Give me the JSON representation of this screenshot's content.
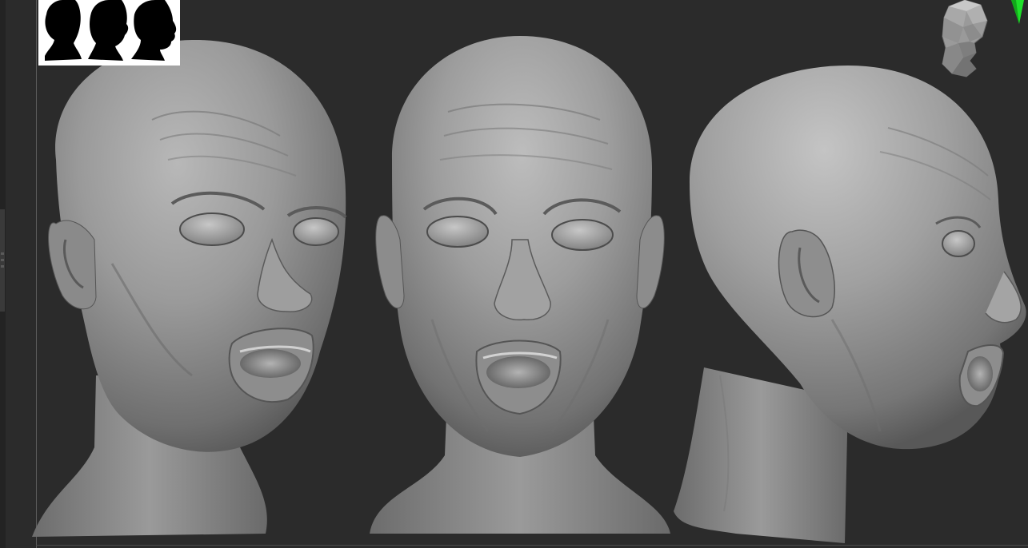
{
  "app": {
    "canvas_background": "#2b2b2b"
  },
  "reference_image": {
    "icon": "head-silhouettes-icon",
    "views": [
      "front",
      "three-quarter",
      "side"
    ],
    "silhouette_color": "#000000",
    "background_color": "#ffffff"
  },
  "models": [
    {
      "view": "three-quarter",
      "icon": "sculpted-head-3q-model"
    },
    {
      "view": "front",
      "icon": "sculpted-head-front-model"
    },
    {
      "view": "profile",
      "icon": "sculpted-head-side-model"
    }
  ],
  "navigation": {
    "icon": "head-nav-cube-icon"
  },
  "marker": {
    "icon": "green-arrow-icon",
    "color": "#1fe02a"
  }
}
